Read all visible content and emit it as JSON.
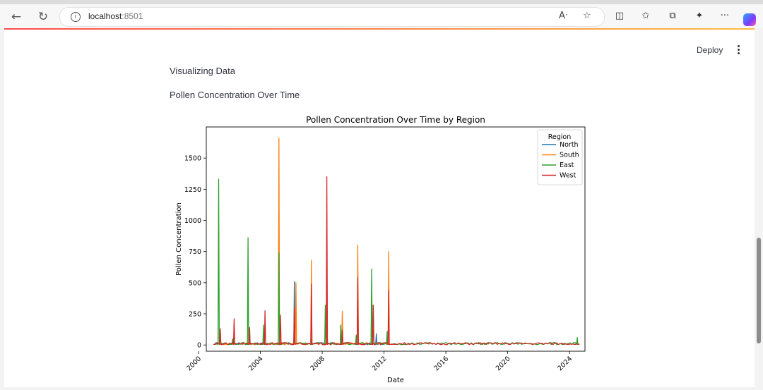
{
  "browser": {
    "url_host": "localhost",
    "url_port": ":8501",
    "icons": [
      "back-arrow-icon",
      "reload-icon",
      "info-icon",
      "read-aloud-icon",
      "favorite-star-icon",
      "split-screen-icon",
      "favorites-icon",
      "collections-icon",
      "extensions-icon",
      "more-icon",
      "copilot-icon"
    ]
  },
  "app": {
    "deploy_label": "Deploy",
    "heading": "Visualizing Data",
    "subheading": "Pollen Concentration Over Time"
  },
  "colors": {
    "North": "#1f77b4",
    "South": "#ff7f0e",
    "East": "#2ca02c",
    "West": "#d62728",
    "accent": "#ff4b4b"
  },
  "chart_data": {
    "type": "line",
    "title": "Pollen Concentration Over Time by Region",
    "xlabel": "Date",
    "ylabel": "Pollen Concentration",
    "xlim": [
      2000.5,
      2025.0
    ],
    "ylim": [
      -50,
      1750
    ],
    "x_ticks": [
      "2000",
      "2004",
      "2008",
      "2012",
      "2016",
      "2020",
      "2024"
    ],
    "y_ticks": [
      "0",
      "250",
      "500",
      "750",
      "1000",
      "1250",
      "1500"
    ],
    "legend_title": "Region",
    "legend_position": "top-right",
    "grid": false,
    "series": [
      {
        "name": "North",
        "x": [
          2001.0,
          2001.4,
          2006.2,
          2008.3,
          2011.3,
          2011.5,
          2012.0
        ],
        "values": [
          5,
          120,
          510,
          250,
          320,
          90,
          8
        ]
      },
      {
        "name": "South",
        "x": [
          2001.0,
          2001.4,
          2005.2,
          2006.3,
          2007.3,
          2008.3,
          2009.3,
          2010.3,
          2011.2,
          2012.3,
          2012.5
        ],
        "values": [
          5,
          130,
          1660,
          500,
          680,
          330,
          270,
          800,
          330,
          750,
          8
        ]
      },
      {
        "name": "East",
        "x": [
          2001.0,
          2001.3,
          2002.2,
          2003.2,
          2004.2,
          2005.2,
          2006.2,
          2007.3,
          2008.2,
          2009.2,
          2010.2,
          2011.2,
          2012.2,
          2012.5,
          2024.5,
          2024.6
        ],
        "values": [
          5,
          1330,
          50,
          860,
          160,
          740,
          60,
          50,
          320,
          160,
          80,
          610,
          110,
          8,
          60,
          5
        ]
      },
      {
        "name": "West",
        "x": [
          2001.0,
          2001.4,
          2002.3,
          2003.3,
          2004.3,
          2005.3,
          2006.2,
          2007.3,
          2008.3,
          2009.3,
          2010.3,
          2011.3,
          2012.3,
          2012.6,
          2024.6
        ],
        "values": [
          5,
          130,
          210,
          140,
          275,
          240,
          300,
          490,
          1350,
          120,
          540,
          320,
          440,
          8,
          8
        ]
      }
    ]
  }
}
